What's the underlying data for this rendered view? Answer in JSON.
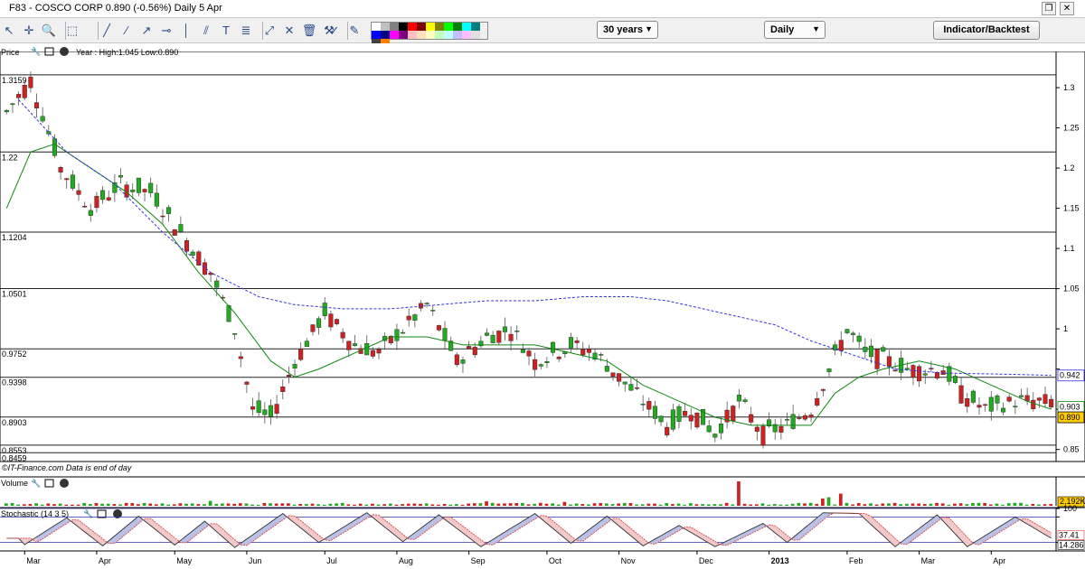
{
  "window": {
    "title": "F83 - COSCO CORP    0.890 (-0.56%)    Daily  5 Apr",
    "restore_glyph": "❐",
    "close_glyph": "✕"
  },
  "toolbar": {
    "range_select": "30 years",
    "interval_select": "Daily",
    "indicator_button": "Indicator/Backtest",
    "dropdown_glyph": "▼",
    "icons": [
      {
        "name": "pointer-icon",
        "glyph": "↖"
      },
      {
        "name": "crosshair-icon",
        "glyph": "✛"
      },
      {
        "name": "zoom-icon",
        "glyph": "🔍"
      },
      {
        "name": "select-icon",
        "glyph": "⬚"
      },
      {
        "name": "trendline-icon",
        "glyph": "╱"
      },
      {
        "name": "line-icon",
        "glyph": "⁄"
      },
      {
        "name": "ray-icon",
        "glyph": "↗"
      },
      {
        "name": "horizontal-line-icon",
        "glyph": "⊸"
      },
      {
        "name": "vertical-line-icon",
        "glyph": "│"
      },
      {
        "name": "channel-icon",
        "glyph": "⫽"
      },
      {
        "name": "text-icon",
        "glyph": "T"
      },
      {
        "name": "fibonacci-icon",
        "glyph": "≣"
      },
      {
        "name": "arc-icon",
        "glyph": "⤢"
      },
      {
        "name": "cross-icon",
        "glyph": "✕"
      },
      {
        "name": "delete-icon",
        "glyph": "🗑"
      },
      {
        "name": "tools-icon",
        "glyph": "⚒"
      },
      {
        "name": "check-icon",
        "glyph": "✓"
      },
      {
        "name": "pencil-icon",
        "glyph": "✎"
      }
    ],
    "palette": [
      "#ffffff",
      "#c0c0c0",
      "#808080",
      "#000000",
      "#ff0000",
      "#800000",
      "#ffff00",
      "#808000",
      "#00ff00",
      "#008000",
      "#00ffff",
      "#008080",
      "#0000ff",
      "#000080",
      "#ff00ff",
      "#800080",
      "#ffc0c0",
      "#ffe0c0",
      "#ffffc0",
      "#c0ffc0",
      "#c0ffff",
      "#c0c0ff",
      "#ffc0ff",
      "#e0e0e0",
      "#404040",
      "#ff8000"
    ]
  },
  "panes": {
    "price": {
      "label": "Price",
      "header": "Year : High:1.045 Low:0.890",
      "source": "©IT-Finance.com  Data is end of day"
    },
    "volume": {
      "label": "Volume"
    },
    "stochastic": {
      "label": "Stochastic (14 3 5)"
    }
  },
  "colors": {
    "up": "#22aa22",
    "down": "#cc2222",
    "sma_short": "#118811",
    "sma_long": "#3333dd",
    "stoch_k": "#333333",
    "stoch_d": "#dd4444",
    "fill_up": "#b8c0e8",
    "fill_down": "#f2c8c8"
  },
  "chart_data": [
    {
      "type": "candlestick",
      "title": "F83 - COSCO CORP",
      "ylim": [
        0.835,
        1.345
      ],
      "y_ticks": [
        0.85,
        0.9,
        0.95,
        1,
        1.05,
        1.1,
        1.15,
        1.2,
        1.25,
        1.3
      ],
      "y_tick_labels": [
        "0.85",
        "0.9",
        "",
        "1",
        "1.05",
        "1.1",
        "1.15",
        "1.2",
        "1.25",
        "1.3"
      ],
      "x_labels": [
        "Mar",
        "Apr",
        "May",
        "Jun",
        "Jul",
        "Aug",
        "Sep",
        "Oct",
        "Nov",
        "Dec",
        "2013",
        "Feb",
        "Mar",
        "Apr"
      ],
      "h_levels": [
        {
          "value": 1.3159,
          "label": "1.3159"
        },
        {
          "value": 1.22,
          "label": "1.22"
        },
        {
          "value": 1.1204,
          "label": "1.1204"
        },
        {
          "value": 1.0501,
          "label": "1.0501"
        },
        {
          "value": 0.9752,
          "label": "0.9752"
        },
        {
          "value": 0.9398,
          "label": "0.9398"
        },
        {
          "value": 0.8903,
          "label": "0.8903"
        },
        {
          "value": 0.8553,
          "label": "0.8553"
        },
        {
          "value": 0.8459,
          "label": "0.8459"
        }
      ],
      "value_labels": [
        {
          "value": 0.942,
          "label": "0.942"
        },
        {
          "value": 0.903,
          "label": "0.903"
        },
        {
          "value": 0.89,
          "label": "0.890"
        }
      ],
      "anchors": [
        [
          0,
          1.27,
          1.31
        ],
        [
          4,
          1.31,
          1.32
        ],
        [
          9,
          1.2,
          1.25
        ],
        [
          14,
          1.15,
          1.17
        ],
        [
          19,
          1.18,
          1.21
        ],
        [
          24,
          1.17,
          1.15
        ],
        [
          29,
          1.12,
          1.09
        ],
        [
          34,
          1.07,
          1.05
        ],
        [
          38,
          1.0,
          0.98
        ],
        [
          41,
          0.9,
          0.88
        ],
        [
          44,
          0.89,
          0.91
        ],
        [
          48,
          0.96,
          0.99
        ],
        [
          53,
          1.02,
          1.0
        ],
        [
          58,
          0.98,
          0.97
        ],
        [
          62,
          0.97,
          0.96
        ],
        [
          66,
          1.0,
          1.02
        ],
        [
          70,
          1.03,
          1.01
        ],
        [
          75,
          0.96,
          0.95
        ],
        [
          80,
          0.99,
          1.02
        ],
        [
          84,
          1.0,
          0.99
        ],
        [
          88,
          0.96,
          0.95
        ],
        [
          94,
          0.98,
          0.99
        ],
        [
          98,
          0.97,
          0.96
        ],
        [
          102,
          0.94,
          0.93
        ],
        [
          106,
          0.91,
          0.9
        ],
        [
          110,
          0.88,
          0.87
        ],
        [
          114,
          0.9,
          0.92
        ],
        [
          118,
          0.87,
          0.86
        ],
        [
          122,
          0.91,
          0.89
        ],
        [
          126,
          0.87,
          0.88
        ],
        [
          130,
          0.88,
          0.89
        ],
        [
          134,
          0.9,
          0.92
        ],
        [
          137,
          0.95,
          0.97
        ],
        [
          140,
          1.0,
          1.02
        ],
        [
          143,
          0.97,
          0.96
        ],
        [
          147,
          0.96,
          0.95
        ],
        [
          150,
          0.95,
          0.94
        ],
        [
          153,
          0.95,
          0.96
        ],
        [
          156,
          0.95,
          0.94
        ],
        [
          159,
          0.92,
          0.91
        ],
        [
          163,
          0.9,
          0.91
        ],
        [
          168,
          0.91,
          0.9
        ],
        [
          172,
          0.91,
          0.9
        ]
      ],
      "sma_short": [
        [
          0,
          1.15
        ],
        [
          4,
          1.22
        ],
        [
          8,
          1.23
        ],
        [
          14,
          1.2
        ],
        [
          20,
          1.17
        ],
        [
          26,
          1.13
        ],
        [
          32,
          1.07
        ],
        [
          38,
          1.02
        ],
        [
          44,
          0.96
        ],
        [
          48,
          0.94
        ],
        [
          52,
          0.95
        ],
        [
          58,
          0.97
        ],
        [
          64,
          0.99
        ],
        [
          70,
          0.99
        ],
        [
          76,
          0.98
        ],
        [
          82,
          0.98
        ],
        [
          88,
          0.98
        ],
        [
          94,
          0.97
        ],
        [
          100,
          0.96
        ],
        [
          106,
          0.93
        ],
        [
          112,
          0.91
        ],
        [
          118,
          0.89
        ],
        [
          124,
          0.88
        ],
        [
          130,
          0.88
        ],
        [
          134,
          0.88
        ],
        [
          138,
          0.92
        ],
        [
          142,
          0.94
        ],
        [
          146,
          0.95
        ],
        [
          152,
          0.96
        ],
        [
          158,
          0.95
        ],
        [
          164,
          0.93
        ],
        [
          170,
          0.91
        ],
        [
          174,
          0.9
        ]
      ],
      "sma_long": [
        [
          2,
          1.285
        ],
        [
          10,
          1.22
        ],
        [
          18,
          1.18
        ],
        [
          26,
          1.12
        ],
        [
          34,
          1.07
        ],
        [
          42,
          1.04
        ],
        [
          48,
          1.03
        ],
        [
          56,
          1.025
        ],
        [
          64,
          1.025
        ],
        [
          72,
          1.03
        ],
        [
          80,
          1.035
        ],
        [
          88,
          1.035
        ],
        [
          96,
          1.04
        ],
        [
          104,
          1.04
        ],
        [
          110,
          1.035
        ],
        [
          116,
          1.025
        ],
        [
          122,
          1.015
        ],
        [
          128,
          1.005
        ],
        [
          134,
          0.985
        ],
        [
          140,
          0.97
        ],
        [
          148,
          0.95
        ],
        [
          156,
          0.945
        ],
        [
          164,
          0.944
        ],
        [
          170,
          0.943
        ],
        [
          174,
          0.942
        ]
      ],
      "n": 175
    },
    {
      "type": "bar",
      "title": "Volume",
      "value_label": "2,192K",
      "spikes": [
        [
          122,
          1.0
        ],
        [
          139,
          0.5
        ],
        [
          137,
          0.35
        ],
        [
          136,
          0.3
        ],
        [
          34,
          0.2
        ],
        [
          80,
          0.18
        ],
        [
          93,
          0.16
        ]
      ]
    },
    {
      "type": "line",
      "title": "Stochastic (14 3 5)",
      "ylim": [
        0,
        100
      ],
      "y_ticks": [
        100,
        80,
        20
      ],
      "y_tick_labels": [
        "100",
        "",
        ""
      ],
      "value_labels": [
        {
          "value": 37.41,
          "label": "37.41"
        },
        {
          "value": 14.28,
          "label": "14.286"
        }
      ],
      "peaks": [
        [
          3,
          15
        ],
        [
          10,
          78
        ],
        [
          16,
          12
        ],
        [
          22,
          82
        ],
        [
          28,
          14
        ],
        [
          33,
          70
        ],
        [
          38,
          8
        ],
        [
          46,
          88
        ],
        [
          52,
          20
        ],
        [
          60,
          90
        ],
        [
          66,
          22
        ],
        [
          72,
          85
        ],
        [
          79,
          10
        ],
        [
          88,
          88
        ],
        [
          94,
          18
        ],
        [
          100,
          82
        ],
        [
          106,
          12
        ],
        [
          112,
          60
        ],
        [
          118,
          10
        ],
        [
          126,
          65
        ],
        [
          130,
          20
        ],
        [
          136,
          90
        ],
        [
          142,
          88
        ],
        [
          148,
          10
        ],
        [
          155,
          85
        ],
        [
          160,
          10
        ],
        [
          168,
          80
        ],
        [
          174,
          30
        ]
      ]
    }
  ]
}
